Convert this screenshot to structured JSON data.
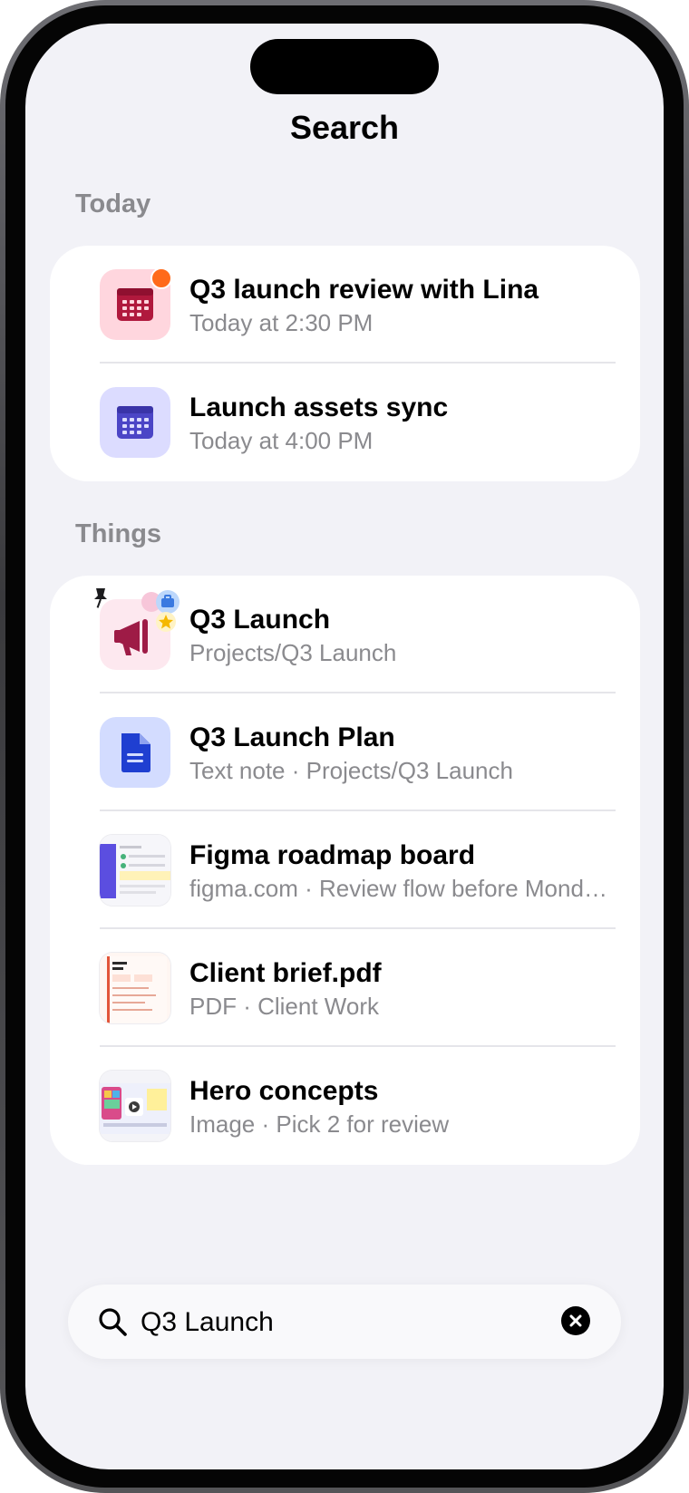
{
  "screen": {
    "title": "Search"
  },
  "sections": [
    {
      "header": "Today",
      "items": [
        {
          "title": "Q3 launch review with Lina",
          "subtitle": "Today at 2:30 PM",
          "icon": "calendar-icon",
          "color": "#ffd6de"
        },
        {
          "title": "Launch assets sync",
          "subtitle": "Today at 4:00 PM",
          "icon": "calendar-icon",
          "color": "#dcdcff"
        }
      ]
    },
    {
      "header": "Things",
      "items": [
        {
          "title": "Q3 Launch",
          "subtitle": "Projects/Q3 Launch",
          "icon": "megaphone-icon"
        },
        {
          "title": "Q3 Launch Plan",
          "subtitle": "Text note · Projects/Q3 Launch",
          "icon": "document-icon"
        },
        {
          "title": "Figma roadmap board",
          "subtitle": "figma.com · Review flow before Monda...",
          "icon": "web-thumbnail"
        },
        {
          "title": "Client brief.pdf",
          "subtitle": "PDF · Client Work",
          "icon": "pdf-thumbnail"
        },
        {
          "title": "Hero concepts",
          "subtitle": "Image · Pick 2 for review",
          "icon": "image-thumbnail"
        }
      ]
    }
  ],
  "search": {
    "value": "Q3 Launch",
    "icon": "search-icon",
    "clear_icon": "clear-icon"
  },
  "colors": {
    "background": "#f2f2f7",
    "notification": "#ff6a1a",
    "calendar_red": "#b0193d",
    "calendar_indigo": "#4b45c6",
    "document_blue": "#1f3fd1"
  }
}
